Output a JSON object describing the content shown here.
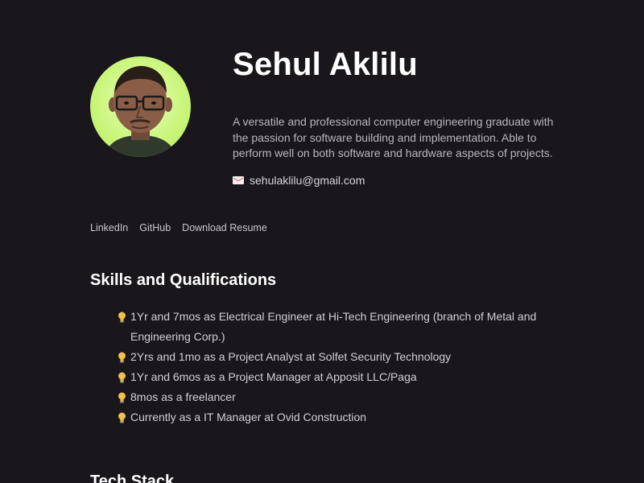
{
  "profile": {
    "name": "Sehul Aklilu",
    "bio": "A versatile and professional computer engineering graduate with the passion for software building and implementation. Able to perform well on both software and hardware aspects of projects.",
    "email": "sehulaklilu@gmail.com",
    "avatar_bg": "#c9f57a"
  },
  "links": [
    {
      "label": "LinkedIn",
      "icon": "linkedin"
    },
    {
      "label": "GitHub",
      "icon": "github"
    },
    {
      "label": "Download Resume",
      "icon": "download"
    }
  ],
  "skills": {
    "title": "Skills and Qualifications",
    "items": [
      "1Yr and 7mos as Electrical Engineer at Hi-Tech Engineering (branch of Metal and Engineering Corp.)",
      "2Yrs and 1mo as a Project Analyst at Solfet Security Technology",
      "1Yr and 6mos as a Project Manager at Apposit LLC/Paga",
      "8mos as a freelancer",
      "Currently as a IT Manager at Ovid Construction"
    ],
    "bullet_icon": "lightbulb-icon"
  },
  "techstack": {
    "title": "Tech Stack"
  },
  "colors": {
    "background": "#19171b",
    "heading": "#ffffff",
    "body_text": "#b9b6bd",
    "bulb": "#f2c14e"
  }
}
